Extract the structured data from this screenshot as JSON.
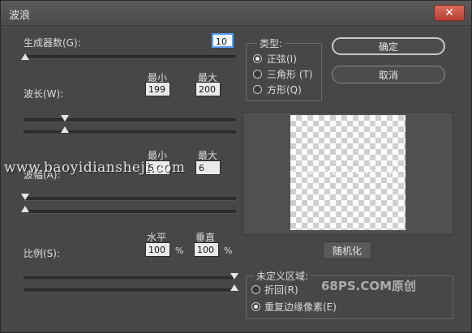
{
  "window": {
    "title": "波浪",
    "close_glyph": "✕"
  },
  "generators": {
    "label": "生成器数(G):",
    "value": "10",
    "slider_fraction": 0.0
  },
  "wavelength": {
    "label": "波长(W):",
    "min_label": "最小",
    "max_label": "最大",
    "min_value": "199",
    "max_value": "200"
  },
  "amplitude": {
    "label": "波幅(A):",
    "min_label": "最小",
    "max_label": "最大",
    "min_value": "5",
    "max_value": "6"
  },
  "scale": {
    "label": "比例(S):",
    "h_label": "水平",
    "v_label": "垂直",
    "h_value": "100",
    "v_value": "100",
    "unit": "%"
  },
  "type_group": {
    "title": "类型:",
    "options": [
      {
        "label": "正弦(I)",
        "checked": true
      },
      {
        "label": "三角形 (T)",
        "checked": false
      },
      {
        "label": "方形(Q)",
        "checked": false
      }
    ]
  },
  "buttons": {
    "ok": "确定",
    "cancel": "取消",
    "randomize": "随机化"
  },
  "undefined_group": {
    "title": "未定义区域:",
    "options": [
      {
        "label": "折回(R)",
        "checked": false
      },
      {
        "label": "重复边缘像素(E)",
        "checked": true
      }
    ]
  },
  "watermarks": {
    "site": "www.baoyidiansheji.com",
    "brand": "68PS.COM原创"
  },
  "colors": {
    "dialog_bg": "#474747",
    "close_red": "#c8503f",
    "focus_blue": "#5aa0ff"
  }
}
